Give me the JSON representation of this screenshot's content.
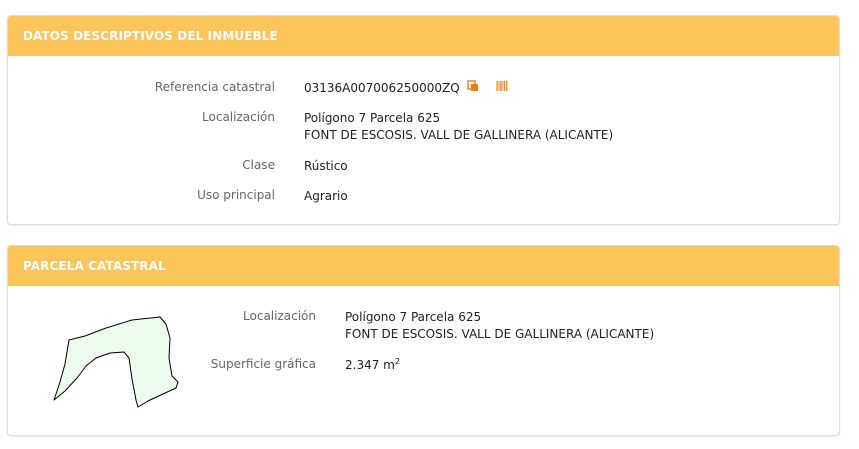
{
  "descriptivos": {
    "header": "DATOS DESCRIPTIVOS DEL INMUEBLE",
    "referencia_label": "Referencia catastral",
    "referencia_value": "03136A007006250000ZQ",
    "localizacion_label": "Localización",
    "localizacion_line1": "Polígono 7 Parcela 625",
    "localizacion_line2": "FONT DE ESCOSIS. VALL DE GALLINERA (ALICANTE)",
    "clase_label": "Clase",
    "clase_value": "Rústico",
    "uso_label": "Uso principal",
    "uso_value": "Agrario",
    "icons": [
      "copy-icon",
      "barcode-icon"
    ]
  },
  "parcela": {
    "header": "PARCELA CATASTRAL",
    "localizacion_label": "Localización",
    "localizacion_line1": "Polígono 7 Parcela 625",
    "localizacion_line2": "FONT DE ESCOSIS. VALL DE GALLINERA (ALICANTE)",
    "superficie_label": "Superficie gráfica",
    "superficie_value": "2.347 m",
    "superficie_unit_exp": "2"
  },
  "colors": {
    "header_bg": "#fcc55a",
    "header_text": "#ffffff",
    "icon_orange": "#f07c1a",
    "parcel_fill": "#ecfbec"
  }
}
